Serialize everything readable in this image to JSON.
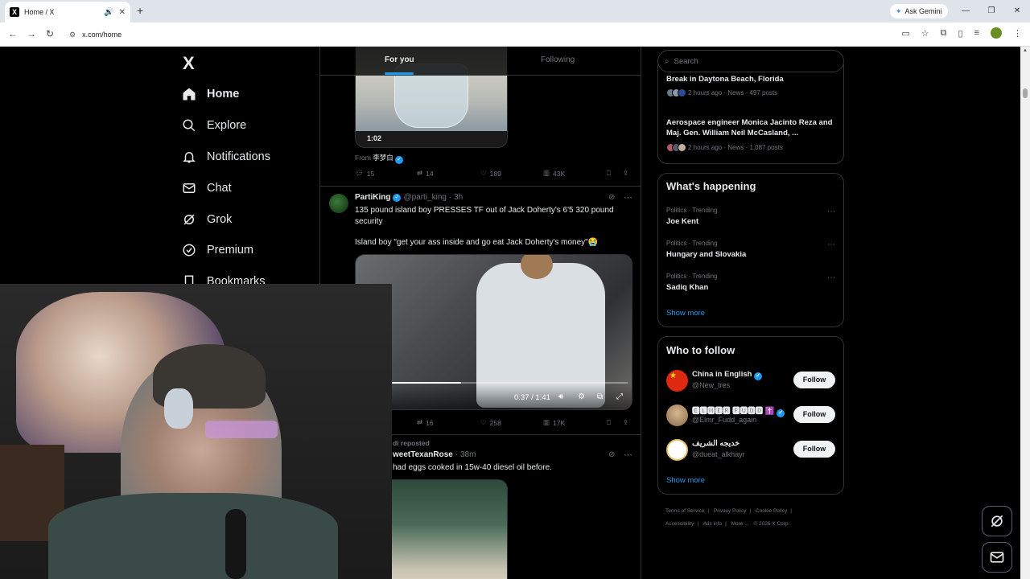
{
  "browser": {
    "tab_title": "Home / X",
    "url": "x.com/home",
    "ask_gemini": "Ask Gemini"
  },
  "nav": {
    "logo": "X",
    "items": [
      {
        "label": "Home",
        "icon": "home-icon"
      },
      {
        "label": "Explore",
        "icon": "search-icon"
      },
      {
        "label": "Notifications",
        "icon": "bell-icon"
      },
      {
        "label": "Chat",
        "icon": "mail-icon"
      },
      {
        "label": "Grok",
        "icon": "grok-icon"
      },
      {
        "label": "Premium",
        "icon": "verified-icon"
      },
      {
        "label": "Bookmarks",
        "icon": "bookmark-icon"
      }
    ]
  },
  "timeline": {
    "tabs": {
      "foryou": "For you",
      "following": "Following"
    },
    "post1": {
      "video_time": "1:02",
      "from_label": "From",
      "from_name": "李梦白",
      "replies": "15",
      "reposts": "14",
      "likes": "189",
      "views": "43K"
    },
    "post2": {
      "name": "PartiKing",
      "handle": "@parti_king",
      "time": "· 3h",
      "text1": "135 pound island boy PRESSES TF out of Jack Doherty's 6'5 320 pound security",
      "text2": "Island boy \"get your ass inside and go eat Jack Doherty's money\"😭",
      "video_time": "0:37 / 1:41",
      "reposts": "16",
      "likes": "258",
      "views": "17K"
    },
    "post3": {
      "repost_label": "di reposted",
      "name": "weetTexanRose",
      "time": "· 38m",
      "text": "had eggs cooked in 15w-40 diesel oil before."
    }
  },
  "sidebar": {
    "search_placeholder": "Search",
    "news": [
      {
        "headline": "Break in Daytona Beach, Florida",
        "meta": "2 hours ago · News · 497 posts"
      },
      {
        "headline": "Aerospace engineer Monica Jacinto Reza and Maj. Gen. William Neil McCasland, ...",
        "meta": "2 hours ago · News · 1,087 posts"
      }
    ],
    "whats_happening": {
      "title": "What's happening",
      "trends": [
        {
          "category": "Politics · Trending",
          "name": "Joe Kent"
        },
        {
          "category": "Politics · Trending",
          "name": "Hungary and Slovakia"
        },
        {
          "category": "Politics · Trending",
          "name": "Sadiq Khan"
        }
      ],
      "show_more": "Show more"
    },
    "who_to_follow": {
      "title": "Who to follow",
      "accounts": [
        {
          "name": "China in English",
          "handle": "@New_tres",
          "button": "Follow"
        },
        {
          "name": "🅴🅻🅼🅴🆁 🅵🆄🅳🅳 ✝️",
          "handle": "@Elmr_Fudd_again",
          "button": "Follow"
        },
        {
          "name": "خديجه الشريف",
          "handle": "@dueat_alkhayr",
          "button": "Follow"
        }
      ],
      "show_more": "Show more"
    },
    "footer": {
      "terms": "Terms of Service",
      "privacy": "Privacy Policy",
      "cookie": "Cookie Policy",
      "accessibility": "Accessibility",
      "ads": "Ads info",
      "more": "More ...",
      "copyright": "© 2026 X Corp."
    }
  },
  "colors": {
    "accent": "#1d9bf0",
    "background": "#000000",
    "text": "#e7e9ea",
    "muted": "#71767b",
    "border": "#2f3336"
  }
}
